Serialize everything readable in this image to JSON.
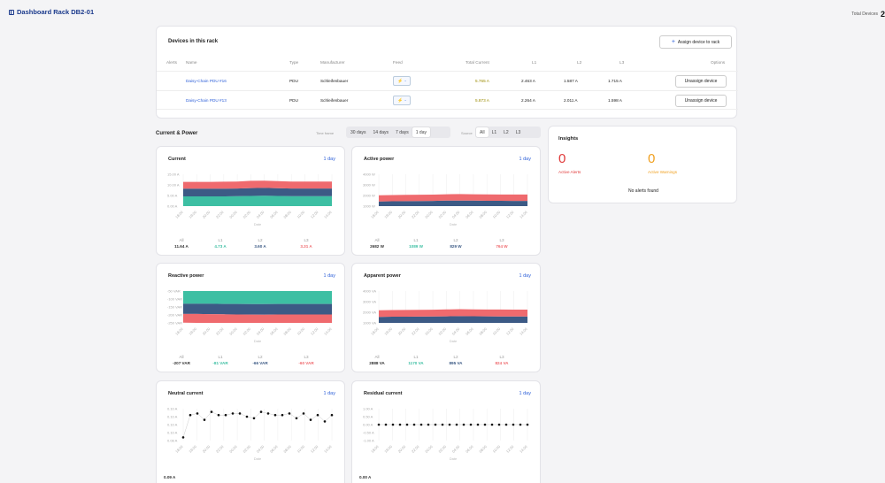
{
  "header": {
    "title": "Dashboard Rack DB2-01",
    "total_devices_label": "Total Devices",
    "total_devices_value": "2"
  },
  "devices": {
    "title": "Devices in this rack",
    "assign_label": "Assign device to rack",
    "columns": {
      "alerts": "Alerts",
      "name": "Name",
      "type": "Type",
      "manufacturer": "Manufacturer",
      "feed": "Feed",
      "total": "Total Current",
      "l1": "L1",
      "l2": "L2",
      "l3": "L3",
      "options": "Options"
    },
    "rows": [
      {
        "name": "Daisy-Chain PDU #16",
        "type": "PDU",
        "manufacturer": "Schleifenbauer",
        "feed": "-",
        "total": "5.765 A",
        "l1": "2.463 A",
        "l2": "1.587 A",
        "l3": "1.715 A",
        "action": "Unassign device"
      },
      {
        "name": "Daisy-Chain PDU #13",
        "type": "PDU",
        "manufacturer": "Schleifenbauer",
        "feed": "-",
        "total": "5.873 A",
        "l1": "2.264 A",
        "l2": "2.011 A",
        "l3": "1.598 A",
        "action": "Unassign device"
      }
    ]
  },
  "section": {
    "title": "Current & Power",
    "timeframe_label": "Time frame",
    "timeframes": [
      "30 days",
      "14 days",
      "7 days",
      "1 day"
    ],
    "timeframe_selected": "1 day",
    "source_label": "Source",
    "sources": [
      "All",
      "L1",
      "L2",
      "L3"
    ],
    "source_selected": "All"
  },
  "insights": {
    "title": "Insights",
    "alerts_count": "0",
    "alerts_label": "Active Alerts",
    "warnings_count": "0",
    "warnings_label": "Active Warnings",
    "empty": "No alerts found"
  },
  "colors": {
    "l1": "#3dbfa3",
    "l2": "#3c5a85",
    "l3": "#ef6a6e",
    "link": "#2d5fd8",
    "alert": "#e03a3a",
    "warning": "#f0a020"
  },
  "xticks": [
    "18:00",
    "19:00",
    "20:00",
    "22:00",
    "00:00",
    "02:00",
    "04:00",
    "06:00",
    "08:00",
    "10:00",
    "12:00",
    "14:00"
  ],
  "xlabel": "Date",
  "chart_data": [
    {
      "id": "current",
      "type": "area",
      "title": "Current",
      "range": "1 day",
      "yticks": [
        "15.00 A",
        "10.00 A",
        "5.00 A",
        "0.00 A"
      ],
      "ylim": [
        0,
        15
      ],
      "stacked": true,
      "series": [
        {
          "name": "L1",
          "values": [
            4.6,
            4.6,
            4.6,
            4.6,
            4.7,
            4.8,
            4.9,
            4.8,
            4.7,
            4.7,
            4.7,
            4.7
          ]
        },
        {
          "name": "L2",
          "values": [
            3.6,
            3.6,
            3.6,
            3.6,
            3.6,
            3.7,
            3.7,
            3.6,
            3.6,
            3.6,
            3.6,
            3.6
          ]
        },
        {
          "name": "L3",
          "values": [
            3.2,
            3.2,
            3.2,
            3.3,
            3.3,
            3.4,
            3.4,
            3.4,
            3.3,
            3.3,
            3.3,
            3.3
          ]
        }
      ],
      "stats": [
        {
          "label": "All",
          "value": "11.64 A"
        },
        {
          "label": "L1",
          "value": "4.73 A"
        },
        {
          "label": "L2",
          "value": "3.60 A"
        },
        {
          "label": "L3",
          "value": "3.31 A"
        }
      ]
    },
    {
      "id": "active",
      "type": "area",
      "title": "Active power",
      "range": "1 day",
      "yticks": [
        "4000 W",
        "3000 W",
        "2000 W",
        "1000 W"
      ],
      "ylim": [
        0,
        4000
      ],
      "ymin_axis": 1000,
      "stacked": true,
      "series": [
        {
          "name": "L1",
          "values": [
            1050,
            1060,
            1070,
            1080,
            1090,
            1100,
            1110,
            1100,
            1090,
            1090,
            1085,
            1085
          ]
        },
        {
          "name": "L2",
          "values": [
            800,
            810,
            815,
            820,
            825,
            840,
            850,
            840,
            830,
            830,
            829,
            829
          ]
        },
        {
          "name": "L3",
          "values": [
            740,
            745,
            750,
            755,
            760,
            770,
            780,
            775,
            768,
            766,
            764,
            764
          ]
        }
      ],
      "stats": [
        {
          "label": "All",
          "value": "2682 W"
        },
        {
          "label": "L1",
          "value": "1089 W"
        },
        {
          "label": "L2",
          "value": "829 W"
        },
        {
          "label": "L3",
          "value": "764 W"
        }
      ]
    },
    {
      "id": "reactive",
      "type": "area",
      "title": "Reactive power",
      "range": "1 day",
      "yticks": [
        "-50 VAR",
        "-100 VAR",
        "-150 VAR",
        "-200 VAR",
        "-250 VAR"
      ],
      "ylim": [
        -250,
        -50
      ],
      "stacked": true,
      "negative": true,
      "series": [
        {
          "name": "L1",
          "values": [
            -80,
            -80,
            -80,
            -81,
            -81,
            -82,
            -82,
            -81,
            -81,
            -81,
            -81,
            -81
          ]
        },
        {
          "name": "L2",
          "values": [
            -64,
            -64,
            -65,
            -65,
            -66,
            -66,
            -67,
            -66,
            -66,
            -66,
            -66,
            -66
          ]
        },
        {
          "name": "L3",
          "values": [
            -55,
            -56,
            -57,
            -58,
            -60,
            -62,
            -63,
            -62,
            -61,
            -60,
            -60,
            -60
          ]
        }
      ],
      "stats": [
        {
          "label": "All",
          "value": "-207 VAR"
        },
        {
          "label": "L1",
          "value": "-81 VAR"
        },
        {
          "label": "L2",
          "value": "-66 VAR"
        },
        {
          "label": "L3",
          "value": "-60 VAR"
        }
      ]
    },
    {
      "id": "apparent",
      "type": "area",
      "title": "Apparent power",
      "range": "1 day",
      "yticks": [
        "4000 VA",
        "3000 VA",
        "2000 VA",
        "1000 VA"
      ],
      "ylim": [
        0,
        4000
      ],
      "ymin_axis": 1000,
      "stacked": true,
      "series": [
        {
          "name": "L1",
          "values": [
            1140,
            1150,
            1155,
            1160,
            1165,
            1175,
            1185,
            1180,
            1172,
            1170,
            1170,
            1170
          ]
        },
        {
          "name": "L2",
          "values": [
            870,
            875,
            880,
            885,
            890,
            900,
            910,
            905,
            897,
            895,
            895,
            895
          ]
        },
        {
          "name": "L3",
          "values": [
            800,
            805,
            810,
            815,
            820,
            830,
            840,
            835,
            828,
            825,
            824,
            824
          ]
        }
      ],
      "stats": [
        {
          "label": "All",
          "value": "2888 VA"
        },
        {
          "label": "L1",
          "value": "1170 VA"
        },
        {
          "label": "L2",
          "value": "895 VA"
        },
        {
          "label": "L3",
          "value": "824 VA"
        }
      ]
    },
    {
      "id": "neutral",
      "type": "scatter",
      "title": "Neutral current",
      "range": "1 day",
      "yticks": [
        "0.10 A",
        "0.10 A",
        "0.10 A",
        "0.10 A",
        "0.08 A"
      ],
      "ylim": [
        0.08,
        0.1
      ],
      "values": [
        0.082,
        0.096,
        0.097,
        0.093,
        0.098,
        0.096,
        0.096,
        0.097,
        0.097,
        0.095,
        0.094,
        0.098,
        0.097,
        0.096,
        0.096,
        0.097,
        0.094,
        0.097,
        0.093,
        0.096,
        0.092,
        0.096
      ],
      "stats": [
        {
          "label": "",
          "value": "0.09 A"
        }
      ]
    },
    {
      "id": "residual",
      "type": "scatter",
      "title": "Residual current",
      "range": "1 day",
      "yticks": [
        "1.00 A",
        "0.50 A",
        "0.00 A",
        "-0.50 A",
        "-1.00 A"
      ],
      "ylim": [
        -1,
        1
      ],
      "values": [
        0,
        0,
        0,
        0,
        0,
        0,
        0,
        0,
        0,
        0,
        0,
        0,
        0,
        0,
        0,
        0,
        0,
        0,
        0,
        0,
        0,
        0
      ],
      "stats": [
        {
          "label": "",
          "value": "0.00 A"
        }
      ]
    }
  ]
}
